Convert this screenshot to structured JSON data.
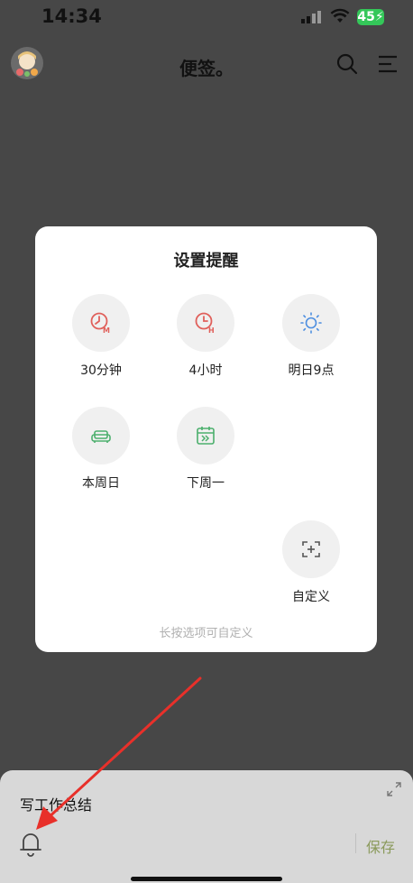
{
  "status_bar": {
    "time": "14:34",
    "battery": "45"
  },
  "app_bar": {
    "title": "便签。"
  },
  "dialog": {
    "title": "设置提醒",
    "options": [
      {
        "label": "30分钟",
        "icon": "clock-m-icon"
      },
      {
        "label": "4小时",
        "icon": "clock-h-icon"
      },
      {
        "label": "明日9点",
        "icon": "sun-icon"
      },
      {
        "label": "本周日",
        "icon": "sofa-icon"
      },
      {
        "label": "下周一",
        "icon": "calendar-icon"
      },
      {
        "label": "自定义",
        "icon": "add-custom-icon"
      }
    ],
    "hint": "长按选项可自定义"
  },
  "note": {
    "text": "写工作总结"
  },
  "bottom_bar": {
    "save_label": "保存"
  },
  "colors": {
    "accent_red": "#e0605b",
    "sun_blue": "#4c8ee0",
    "green": "#4caf6d",
    "save_color": "#8a9a5b"
  }
}
